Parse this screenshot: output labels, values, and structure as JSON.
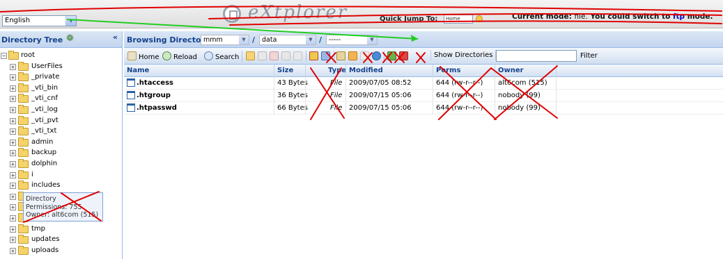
{
  "topbar": {
    "language": "English",
    "logo_text": "eXtplorer",
    "quick_jump_label": "Quick Jump To:",
    "quick_jump_value": "Home",
    "mode_prefix": "Current mode:",
    "mode_value": "file.",
    "mode_mid": "You could switch to",
    "mode_link": "ftp",
    "mode_suffix": "mode."
  },
  "tree": {
    "title": "Directory Tree",
    "root_label": "root",
    "items": [
      "UserFiles",
      "_private",
      "_vti_bin",
      "_vti_cnf",
      "_vti_log",
      "_vti_pvt",
      "_vti_txt",
      "admin",
      "backup",
      "dolphin",
      "i",
      "includes",
      "",
      "",
      "",
      "tmp",
      "updates",
      "uploads"
    ],
    "tooltip": {
      "line1": "Directory",
      "line2": "Permissions: 755",
      "line3": "Owner: alt6com (515)"
    }
  },
  "main": {
    "title": "Browsing Directory",
    "path_parts": [
      "mmm",
      "data",
      "-----"
    ],
    "toolbar": {
      "home": "Home",
      "reload": "Reload",
      "search": "Search",
      "show_directories": "Show Directories",
      "filter": "Filter"
    },
    "columns": [
      "Name",
      "Size",
      "Type",
      "Modified",
      "Perms",
      "Owner"
    ],
    "rows": [
      {
        "name": ".htaccess",
        "size": "43 Bytes",
        "type": "File",
        "modified": "2009/07/05 08:52",
        "perms": "644 (rw-r--r--)",
        "owner": "alt6com (515)"
      },
      {
        "name": ".htgroup",
        "size": "36 Bytes",
        "type": "File",
        "modified": "2009/07/15 05:06",
        "perms": "644 (rw-r--r--)",
        "owner": "nobody (99)"
      },
      {
        "name": ".htpasswd",
        "size": "66 Bytes",
        "type": "File",
        "modified": "2009/07/15 05:06",
        "perms": "644 (rw-r--r--)",
        "owner": "nobody (99)"
      }
    ]
  },
  "colors": {
    "header_text": "#15428b",
    "annotation_red": "#e00000",
    "annotation_green": "#22cc22",
    "link": "#0000cc"
  }
}
